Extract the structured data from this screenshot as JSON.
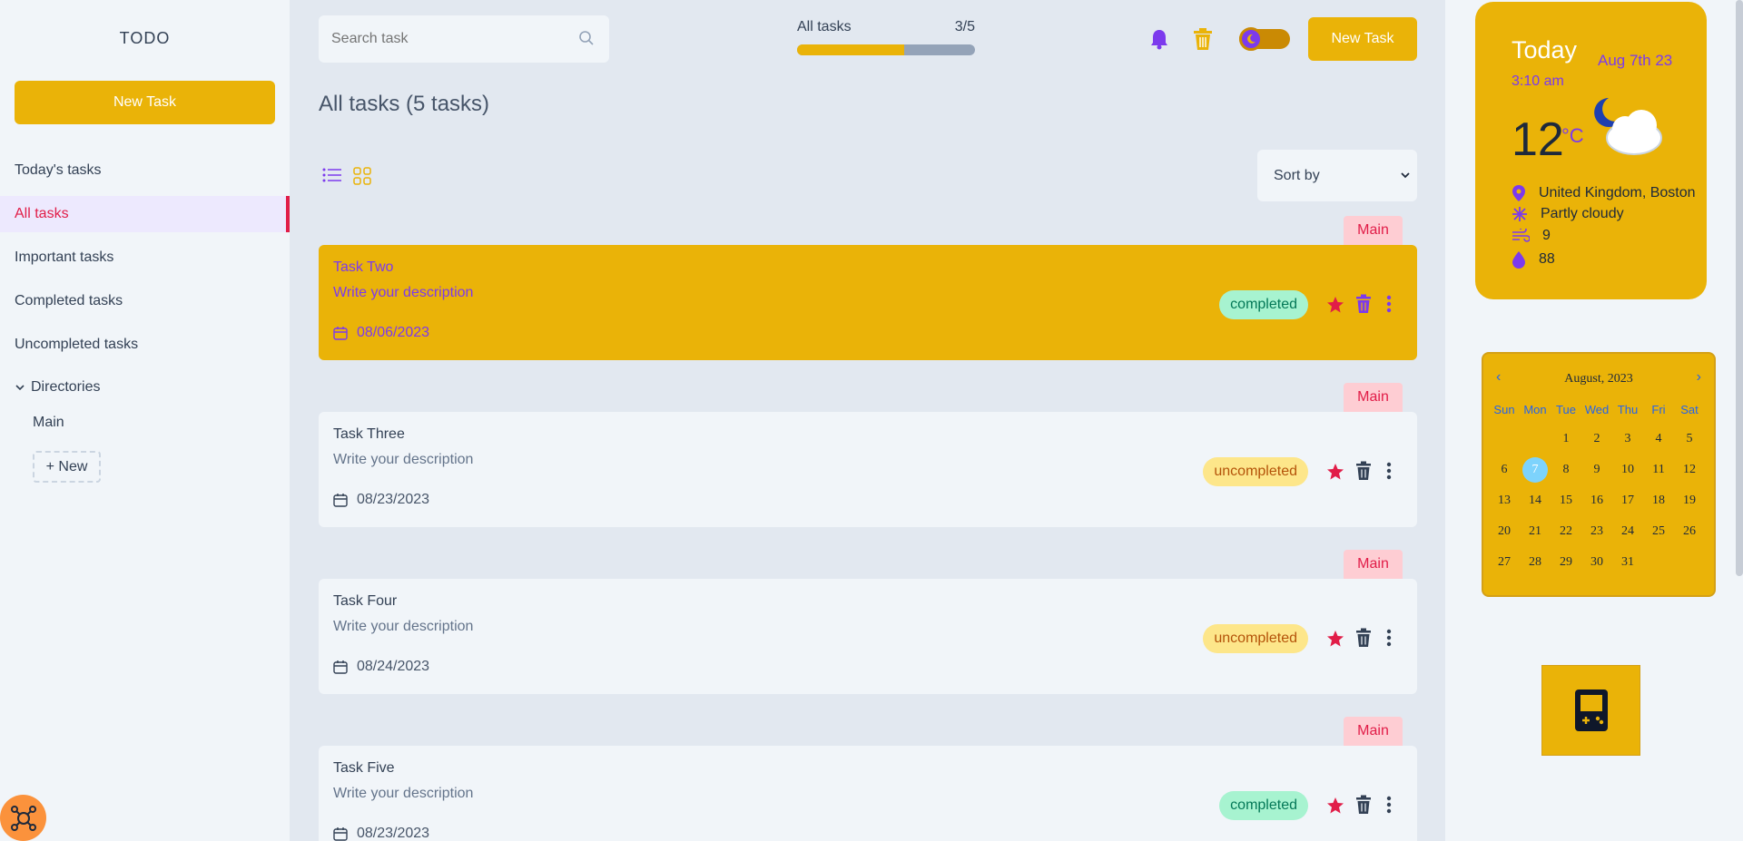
{
  "sidebar": {
    "logo": "TODO",
    "new_task": "New Task",
    "nav": [
      "Today's tasks",
      "All tasks",
      "Important tasks",
      "Completed tasks",
      "Uncompleted tasks"
    ],
    "directories_label": "Directories",
    "directories": [
      "Main"
    ],
    "new_dir": "+ New"
  },
  "header": {
    "search_placeholder": "Search task",
    "progress_label": "All tasks",
    "progress_count": "3/5",
    "progress_fraction": 0.6,
    "new_task": "New Task"
  },
  "main": {
    "title": "All tasks (5 tasks)",
    "sort_label": "Sort by",
    "tasks": [
      {
        "dir": "Main",
        "title": "Task Two",
        "desc": "Write your description",
        "date": "08/06/2023",
        "status": "completed"
      },
      {
        "dir": "Main",
        "title": "Task Three",
        "desc": "Write your description",
        "date": "08/23/2023",
        "status": "uncompleted"
      },
      {
        "dir": "Main",
        "title": "Task Four",
        "desc": "Write your description",
        "date": "08/24/2023",
        "status": "uncompleted"
      },
      {
        "dir": "Main",
        "title": "Task Five",
        "desc": "Write your description",
        "date": "08/23/2023",
        "status": "completed"
      }
    ]
  },
  "weather": {
    "today": "Today",
    "date": "Aug 7th 23",
    "time": "3:10 am",
    "temp": "12",
    "unit": "°C",
    "location": "United Kingdom, Boston",
    "condition": "Partly cloudy",
    "wind": "9",
    "humidity": "88"
  },
  "calendar": {
    "month": "August, 2023",
    "weekdays": [
      "Sun",
      "Mon",
      "Tue",
      "Wed",
      "Thu",
      "Fri",
      "Sat"
    ],
    "days": [
      "",
      "",
      "1",
      "2",
      "3",
      "4",
      "5",
      "6",
      "7",
      "8",
      "9",
      "10",
      "11",
      "12",
      "13",
      "14",
      "15",
      "16",
      "17",
      "18",
      "19",
      "20",
      "21",
      "22",
      "23",
      "24",
      "25",
      "26",
      "27",
      "28",
      "29",
      "30",
      "31"
    ],
    "today": "7"
  },
  "colors": {
    "accent": "#eab308",
    "primary": "#7c3aed",
    "danger": "#e11d48"
  }
}
